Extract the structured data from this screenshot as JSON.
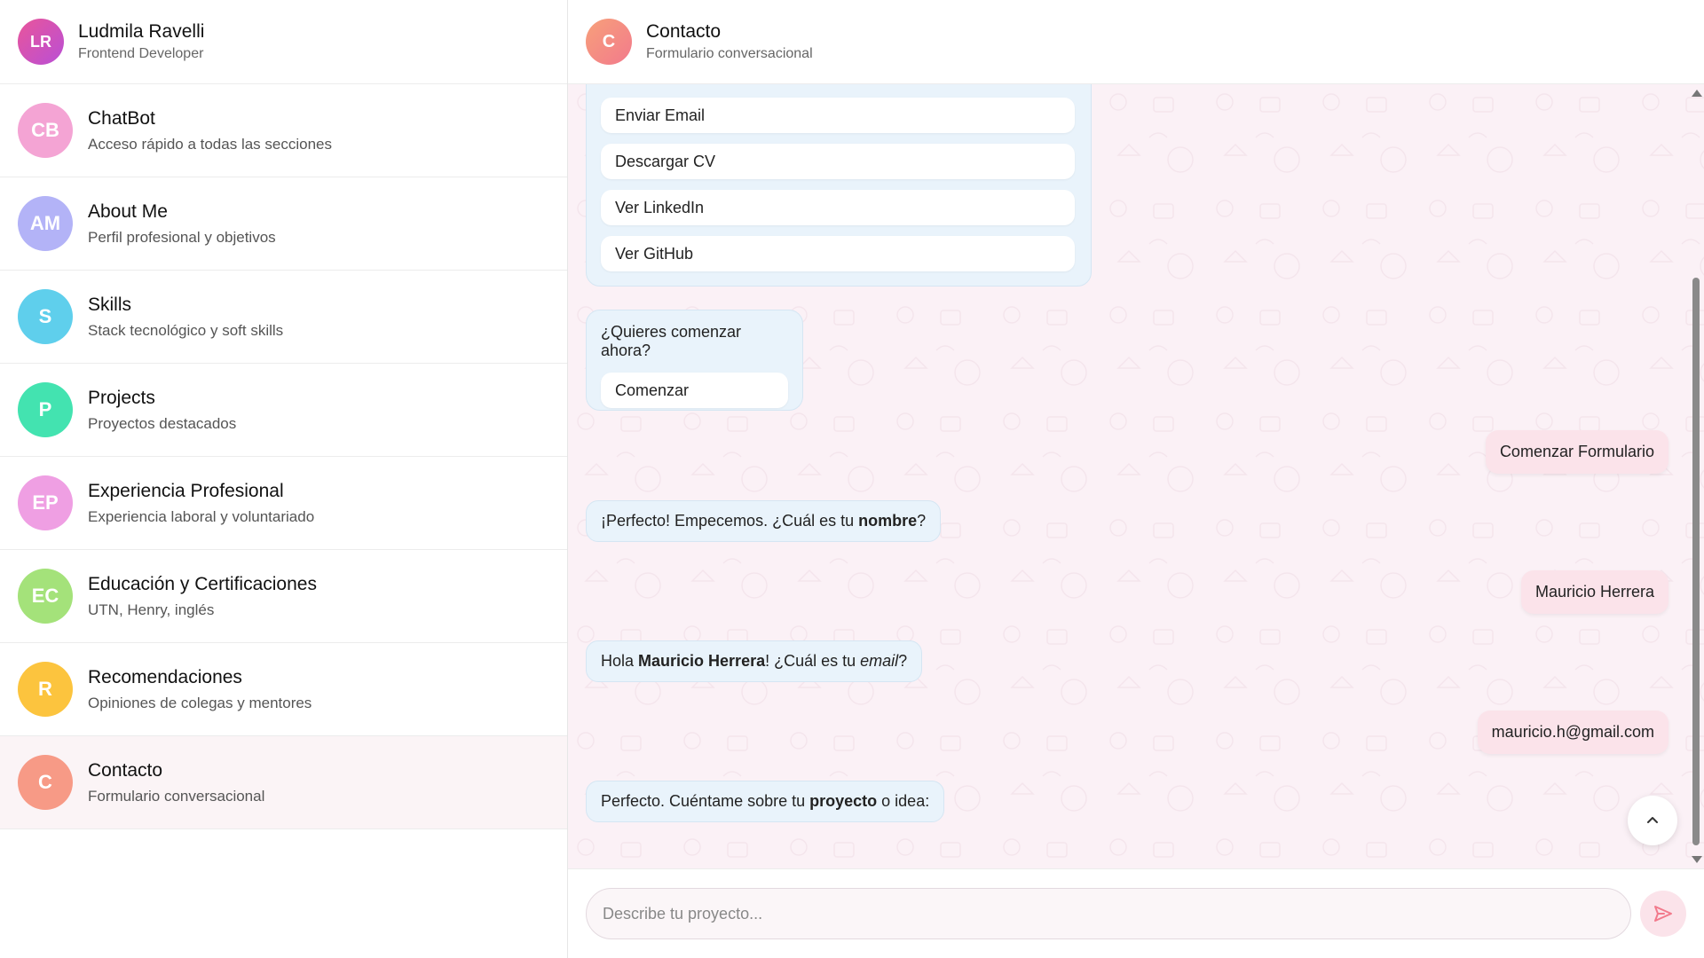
{
  "profile": {
    "initials": "LR",
    "name": "Ludmila Ravelli",
    "role": "Frontend Developer"
  },
  "sidebar": {
    "items": [
      {
        "initials": "CB",
        "title": "ChatBot",
        "subtitle": "Acceso rápido a todas las secciones",
        "color": "#f4a4d4"
      },
      {
        "initials": "AM",
        "title": "About Me",
        "subtitle": "Perfil profesional y objetivos",
        "color": "#b3b3f7"
      },
      {
        "initials": "S",
        "title": "Skills",
        "subtitle": "Stack tecnológico y soft skills",
        "color": "#5fcfec"
      },
      {
        "initials": "P",
        "title": "Projects",
        "subtitle": "Proyectos destacados",
        "color": "#43e3b0"
      },
      {
        "initials": "EP",
        "title": "Experiencia Profesional",
        "subtitle": "Experiencia laboral y voluntariado",
        "color": "#ef9fe3"
      },
      {
        "initials": "EC",
        "title": "Educación y Certificaciones",
        "subtitle": "UTN, Henry, inglés",
        "color": "#a4e27a"
      },
      {
        "initials": "R",
        "title": "Recomendaciones",
        "subtitle": "Opiniones de colegas y mentores",
        "color": "#fcc43e"
      },
      {
        "initials": "C",
        "title": "Contacto",
        "subtitle": "Formulario conversacional",
        "color": "#f79a86"
      }
    ]
  },
  "chat": {
    "initials": "C",
    "title": "Contacto",
    "status": "Formulario conversacional",
    "options": [
      "Enviar Email",
      "Descargar CV",
      "Ver LinkedIn",
      "Ver GitHub"
    ],
    "start_question": "¿Quieres comenzar ahora?",
    "start_button": "Comenzar",
    "msg_out_1": "Comenzar Formulario",
    "msg_in_1": {
      "pre": "¡Perfecto! Empecemos. ¿Cuál es tu ",
      "bold": "nombre",
      "post": "?"
    },
    "msg_out_2": "Mauricio Herrera",
    "msg_in_2": {
      "pre": "Hola ",
      "bold": "Mauricio Herrera",
      "mid": "! ¿Cuál es tu ",
      "italic": "email",
      "post": "?"
    },
    "msg_out_3": "mauricio.h@gmail.com",
    "msg_in_3": {
      "pre": "Perfecto. Cuéntame sobre tu ",
      "bold": "proyecto",
      "post": " o idea:"
    },
    "scroll_up_icon": "chevron-up-icon"
  },
  "composer": {
    "placeholder": "Describe tu proyecto...",
    "send_icon": "send-icon"
  },
  "colors": {
    "accent": "#f27a8c",
    "bubble_in": "#e9f3fb",
    "bubble_out": "#fbe3ea",
    "chat_bg": "#fbf1f6"
  }
}
